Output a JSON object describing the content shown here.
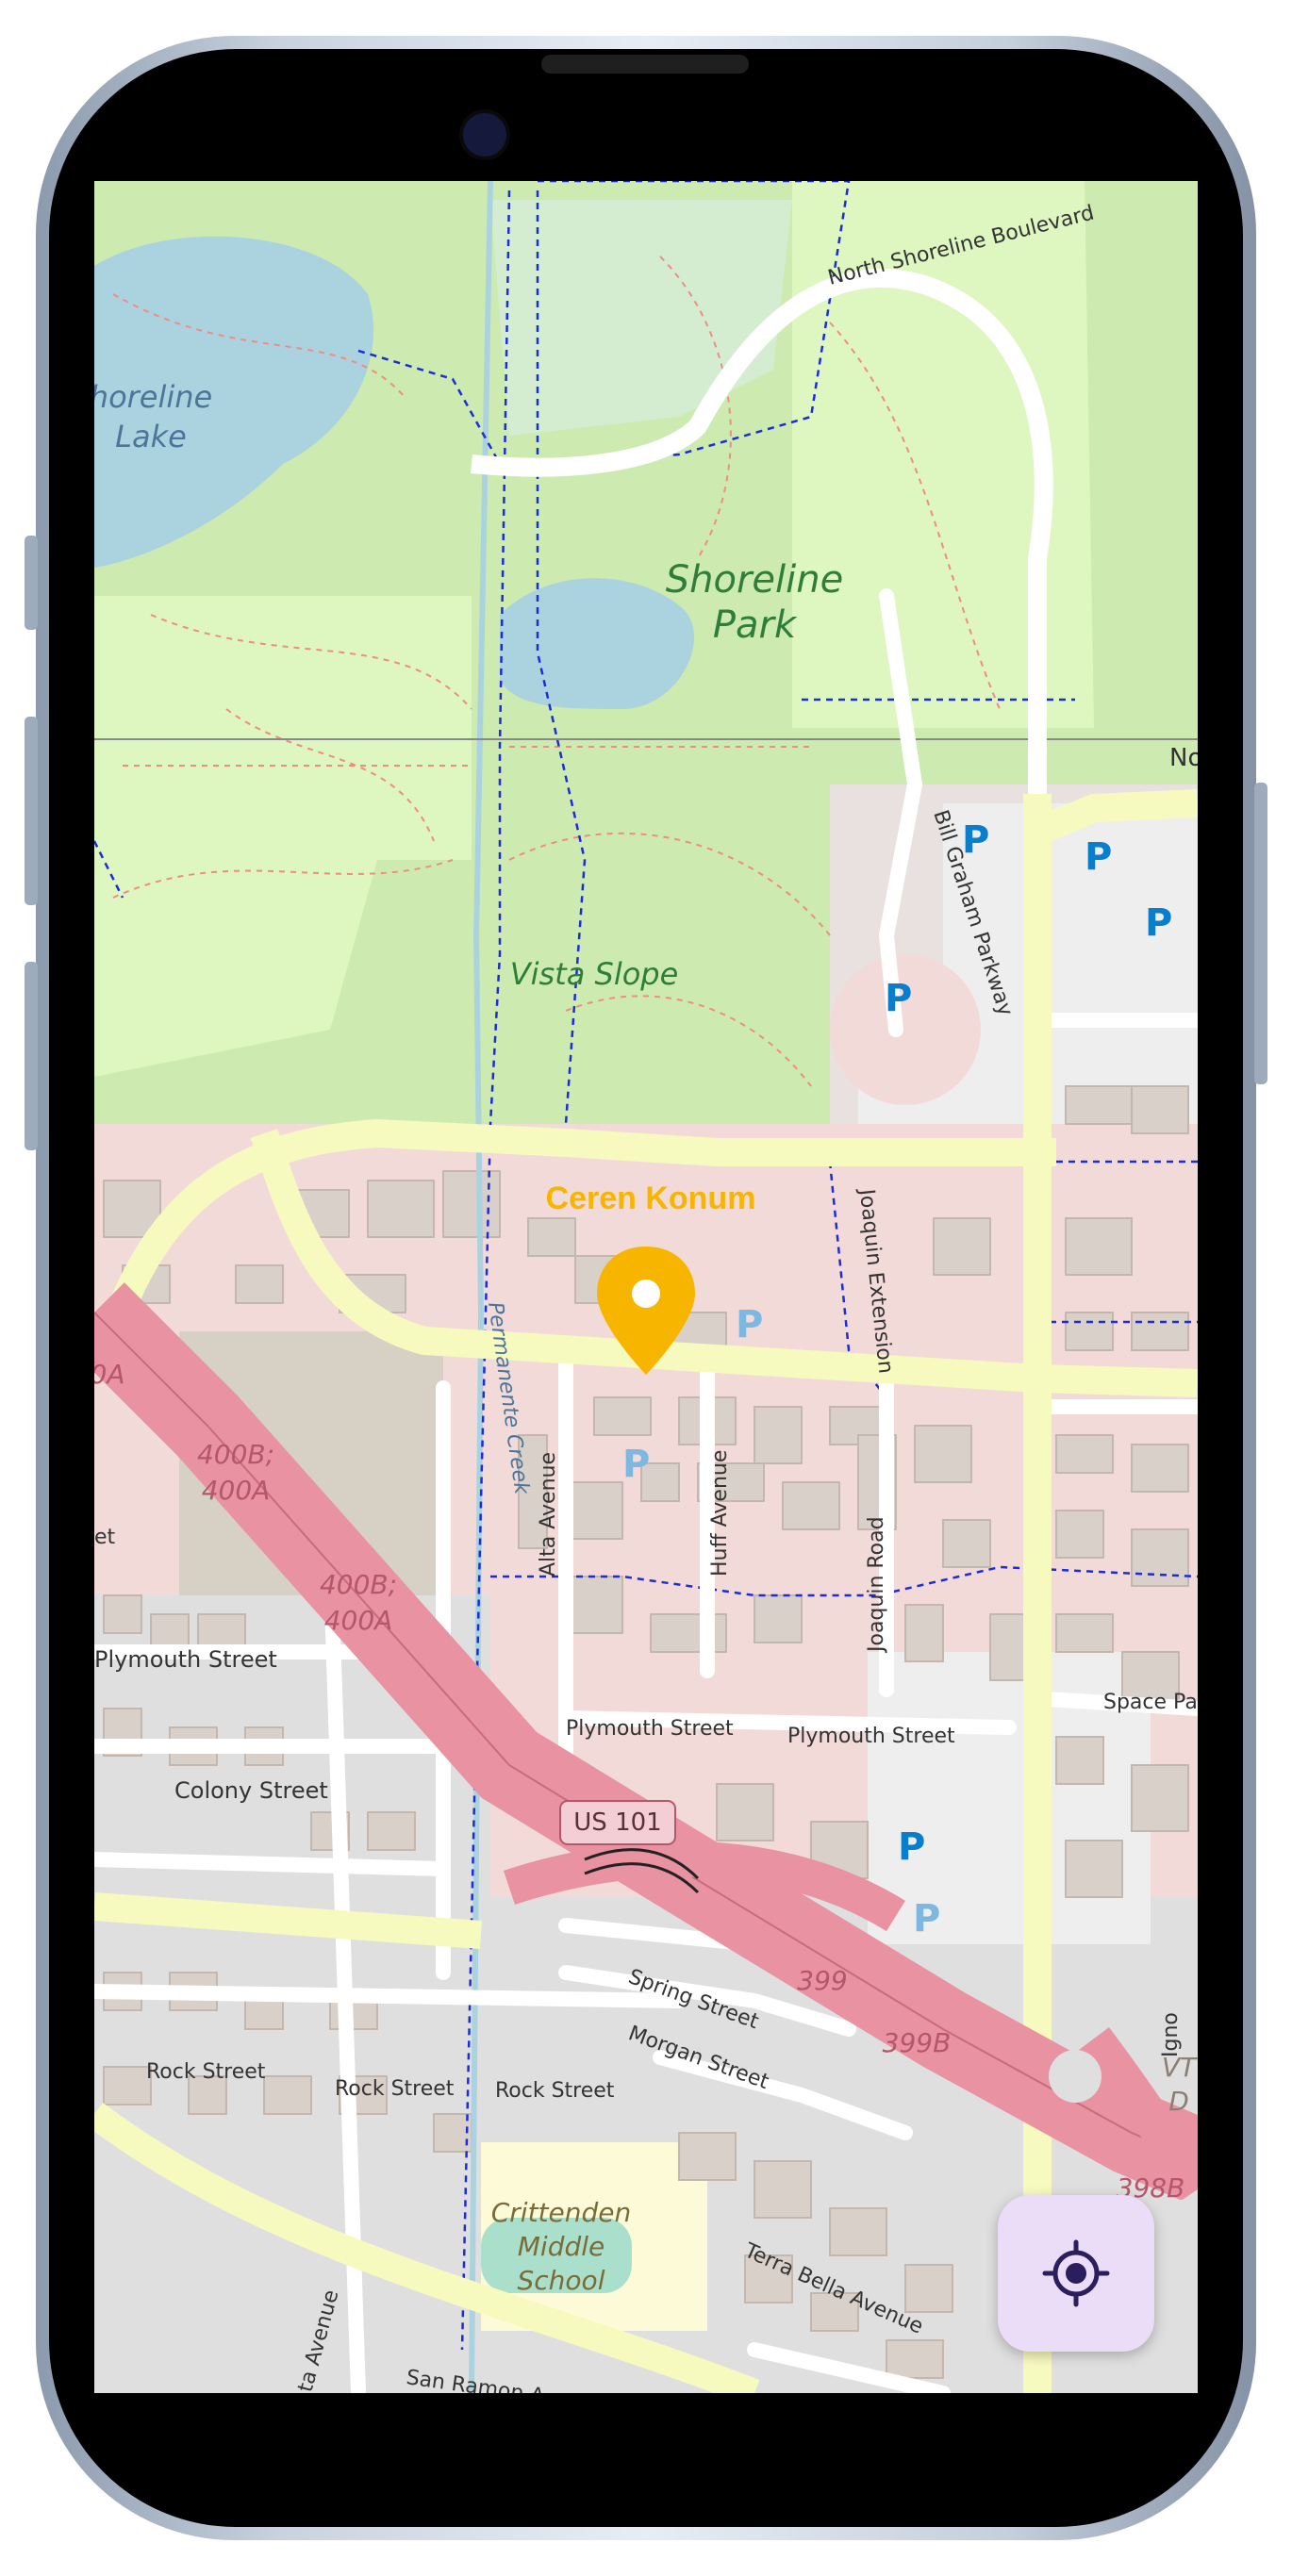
{
  "marker": {
    "label": "Ceren Konum",
    "color": "#f7b500"
  },
  "map": {
    "labels": {
      "lake": "Shoreline Lake",
      "lake_1": "horeline",
      "lake_2": "Lake",
      "park_1": "Shoreline",
      "park_2": "Park",
      "vista": "Vista Slope",
      "shoreline_blvd": "North Shoreline Boulevard",
      "bill_graham": "Bill Graham Parkway",
      "joaquin_ext": "Joaquin Extension",
      "permanente": "Permanente Creek",
      "alta": "Alta Avenue",
      "huff": "Huff Avenue",
      "joaquin_rd": "Joaquin Road",
      "plymouth": "Plymouth Street",
      "colony": "Colony Street",
      "us101": "US 101",
      "exit_400b_1a": "400B;",
      "exit_400a_1": "400A",
      "exit_400b_2a": "400B;",
      "exit_400a_2": "400A",
      "exit_0a": "0A",
      "exit_399": "399",
      "exit_399b": "399B",
      "exit_398b": "398B",
      "space_park": "Space Pa",
      "spring": "Spring Street",
      "morgan": "Morgan Street",
      "rock": "Rock Street",
      "crittenden_1": "Crittenden",
      "crittenden_2": "Middle",
      "crittenden_3": "School",
      "terra_bella": "Terra Bella Avenue",
      "san_ramon": "San Ramon A",
      "north_cut": "No",
      "vt": "VT",
      "vt_d": "D",
      "ta_avenue": "ta Avenue",
      "ignore": "Igno",
      "et": "et"
    },
    "parking_label": "P",
    "colors": {
      "park": "#cdebb0",
      "golf": "#def6c0",
      "water": "#aad3df",
      "major_road": "#f7fabf",
      "highway": "#e892a2",
      "residential": "#e0dfdf",
      "building": "#d9d0c9",
      "parking": "#0b7ecb"
    }
  },
  "locate_button": {
    "icon": "crosshair-icon",
    "color": "#2a1f5c"
  }
}
